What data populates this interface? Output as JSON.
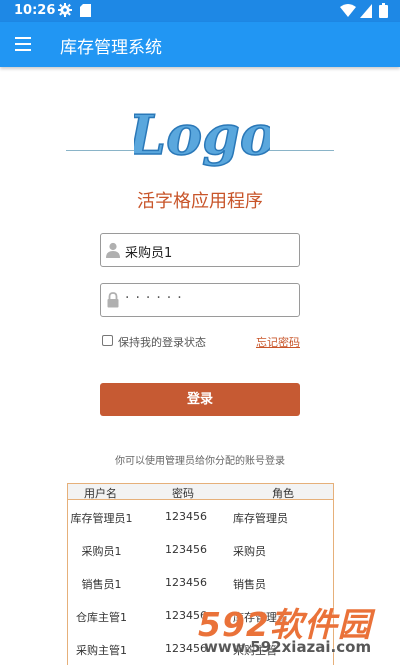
{
  "status_bar": {
    "time": "10:26"
  },
  "app_bar": {
    "title": "库存管理系统"
  },
  "logo": {
    "text": "Logo"
  },
  "app_name": "活字格应用程序",
  "login": {
    "username_value": "采购员1",
    "password_mask": "······",
    "remember_label": "保持我的登录状态",
    "forgot_label": "忘记密码",
    "submit_label": "登录"
  },
  "hint": "你可以使用管理员给你分配的账号登录",
  "accounts_table": {
    "headers": [
      "用户名",
      "密码",
      "角色"
    ],
    "rows": [
      [
        "库存管理员1",
        "123456",
        "库存管理员"
      ],
      [
        "采购员1",
        "123456",
        "采购员"
      ],
      [
        "销售员1",
        "123456",
        "销售员"
      ],
      [
        "仓库主管1",
        "123456",
        "库存管理员"
      ],
      [
        "采购主管1",
        "123456",
        "采购主管"
      ]
    ]
  },
  "watermark": {
    "brand": "592软件园",
    "url": "www.592xiazai.com"
  }
}
